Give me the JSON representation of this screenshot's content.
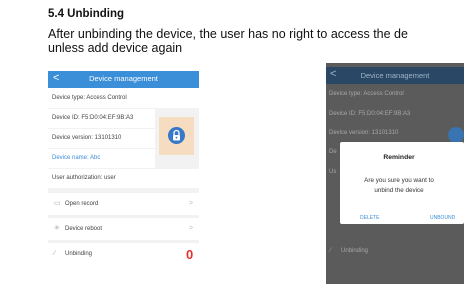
{
  "section": {
    "heading": "5.4 Unbinding",
    "line1": "After unbinding the device, the user has no right to access the de",
    "line2": "unless add device again"
  },
  "left_screen": {
    "title": "Device management",
    "back_glyph": "<",
    "info_rows": [
      "Device type: Access Control",
      "Device ID: F5:D0:04:EF:9B:A3",
      "Device version: 13101310",
      "Device name: Abc",
      "User authorization: user"
    ],
    "actions": [
      {
        "label": "Open record",
        "icon": "record-icon"
      },
      {
        "label": "Device reboot",
        "icon": "reboot-icon"
      },
      {
        "label": "Unbinding",
        "icon": "unbind-icon"
      }
    ],
    "chevron": ">",
    "annotation_mark": "0",
    "colors": {
      "bar": "#3b8ed8",
      "lock": "#3579c8",
      "lock_bg": "#f6dcc0",
      "annotation": "#e23030"
    }
  },
  "right_screen": {
    "title": "Device management",
    "back_glyph": "<",
    "info_lines": [
      "Device type: Access Control",
      "Device ID: F5:D0:04:EF:9B:A3",
      "Device version: 13101310",
      "De",
      "Us"
    ],
    "dialog": {
      "title": "Reminder",
      "message_line1": "Are you sure you want to",
      "message_line2": "unbind the device",
      "delete_label": "DELETE",
      "unbound_label": "UNBOUND"
    },
    "bottom_item": "Unbinding"
  }
}
